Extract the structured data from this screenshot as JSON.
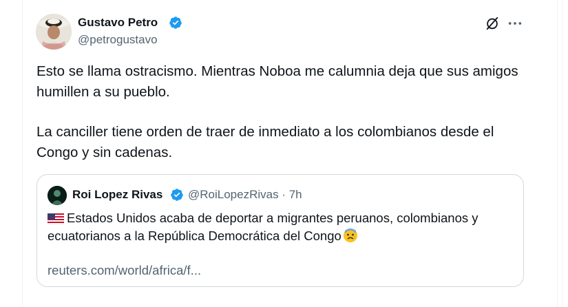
{
  "author": {
    "name": "Gustavo Petro",
    "handle": "@petrogustavo",
    "verified": true,
    "avatar_icon": "profile-avatar"
  },
  "post": {
    "paragraphs": [
      "Esto se llama ostracismo. Mientras Noboa me calumnia deja que sus amigos humillen a su pueblo.",
      "La canciller tiene orden de traer de inmediato a los colombianos desde el Congo y sin cadenas."
    ]
  },
  "header_actions": {
    "grok_icon": "grok-icon",
    "more_icon": "more-options-icon"
  },
  "quoted": {
    "name": "Roi Lopez Rivas",
    "handle_time": "@RoiLopezRivas · 7h",
    "verified": true,
    "text": "Estados Unidos acaba de deportar a migrantes peruanos, colombianos y ecuatorianos a la República Democrática del Congo",
    "flag_icon": "us-flag-icon",
    "emoji_icon": "anxious-face-emoji",
    "link": "reuters.com/world/africa/f..."
  },
  "colors": {
    "text": "#0f1419",
    "secondary": "#536471",
    "verified": "#1d9bf0",
    "border": "#cfd9de"
  }
}
